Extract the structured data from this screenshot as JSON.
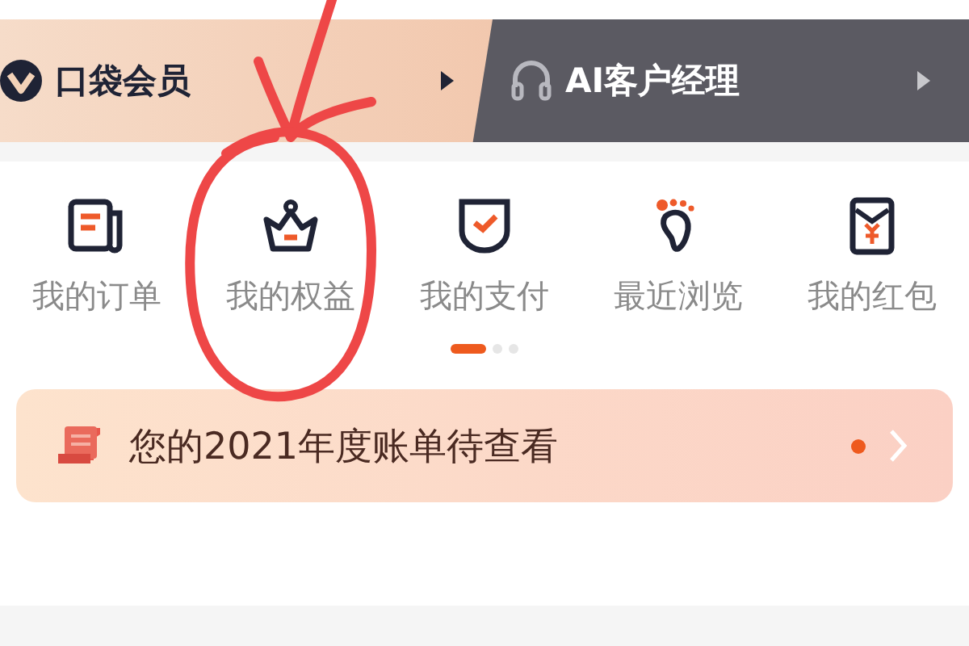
{
  "banner": [
    {
      "kind": "member",
      "label": "口袋会员"
    },
    {
      "kind": "manager",
      "label": "AI客户经理"
    }
  ],
  "shortcuts": [
    {
      "kind": "orders",
      "label": "我的订单"
    },
    {
      "kind": "benefits",
      "label": "我的权益"
    },
    {
      "kind": "payment",
      "label": "我的支付"
    },
    {
      "kind": "history",
      "label": "最近浏览"
    },
    {
      "kind": "redpacket",
      "label": "我的红包"
    }
  ],
  "pager": [
    {
      "selected": true
    },
    {
      "selected": false
    },
    {
      "selected": false
    }
  ],
  "bill_notice": {
    "text": "您的2021年度账单待查看",
    "unread": true
  }
}
